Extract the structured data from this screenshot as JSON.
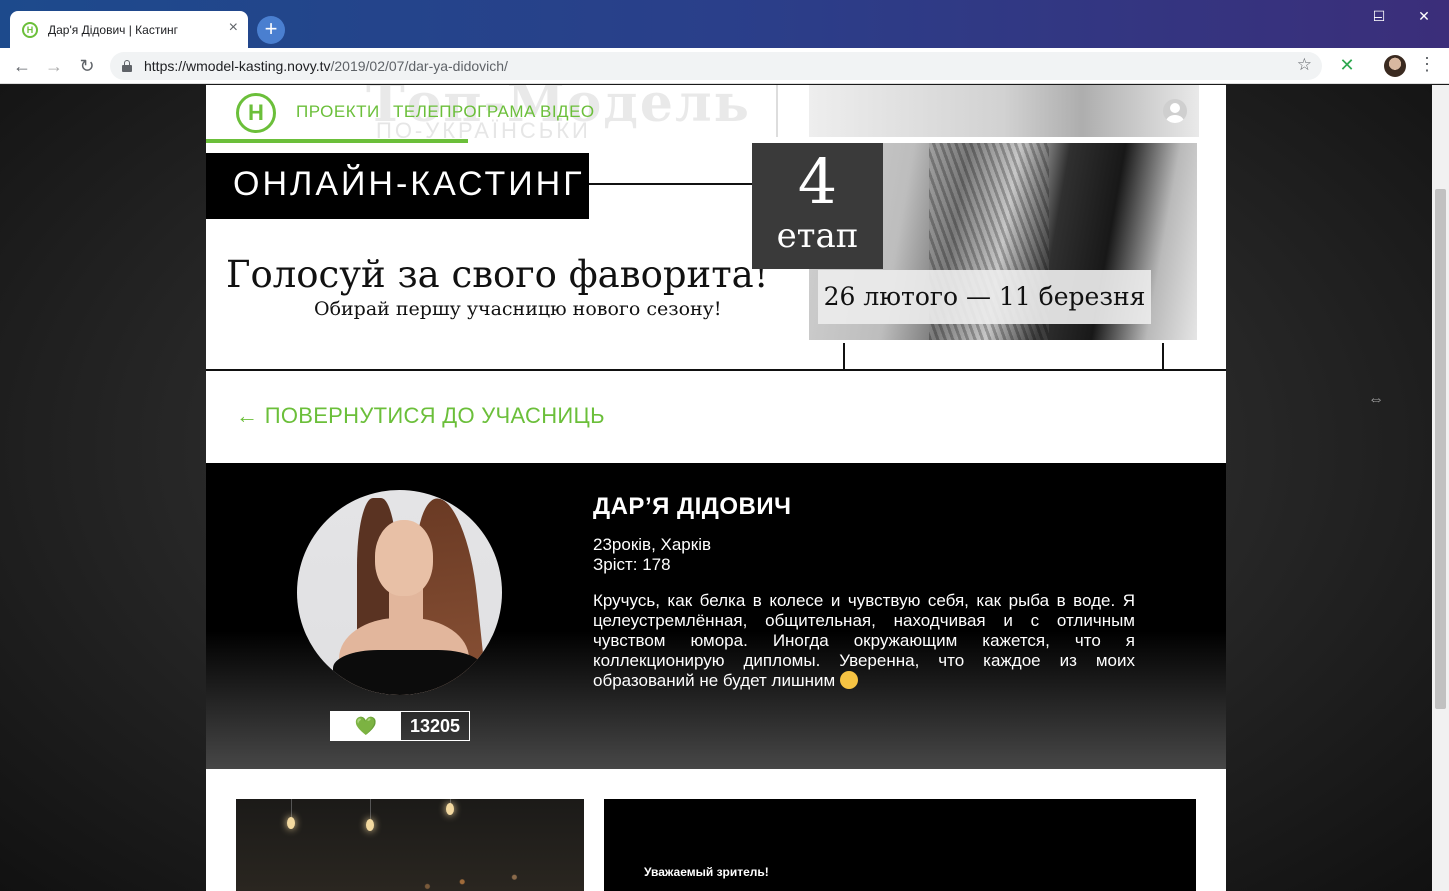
{
  "browser": {
    "tab_title": "Дар'я Дідович | Кастинг",
    "tab_close": "×",
    "new_tab": "+",
    "url_host": "https://wmodel-kasting.novy.tv",
    "url_path": "/2019/02/07/dar-ya-didovich/",
    "window_controls": [
      "–",
      "☐",
      "✕"
    ],
    "nav": {
      "back": "←",
      "forward": "→",
      "reload": "↻"
    },
    "star": "☆",
    "menu": "⋮"
  },
  "header": {
    "logo_letter": "Н",
    "nav_items": [
      "ПРОЕКТИ",
      "ТЕЛЕПРОГРАМА",
      "ВІДЕО"
    ],
    "bg_word": "Топ-Модель",
    "bg_word_sub": "ПО-УКРАЇНСЬКИ",
    "accent_color": "#6bbf3a"
  },
  "banner": {
    "casting_label": "ОНЛАЙН-КАСТИНГ",
    "headline": "Голосуй за свого фаворита!",
    "subline": "Обирай першу учасницю нового сезону!",
    "stage_number": "4",
    "stage_word": "етап",
    "dates": "26 лютого — 11 березня"
  },
  "back_link": "← ПОВЕРНУТИСЯ ДО УЧАСНИЦЬ",
  "profile": {
    "name": "ДАР’Я ДІДОВИЧ",
    "age_city": "23років, Харків",
    "height": "Зріст: 178",
    "bio": "Кручусь, как белка в колесе и чувствую себя, как рыба в воде. Я целеустремлённая, общительная, находчивая и с отличным чувством юмора. Иногда окружающим кажется, что я коллекционирую дипломы. Уверенна, что каждое из моих образований не будет лишним",
    "vote_icon": "💚",
    "vote_count": "13205"
  },
  "notice": {
    "text": "Уважаемый зритель!"
  }
}
